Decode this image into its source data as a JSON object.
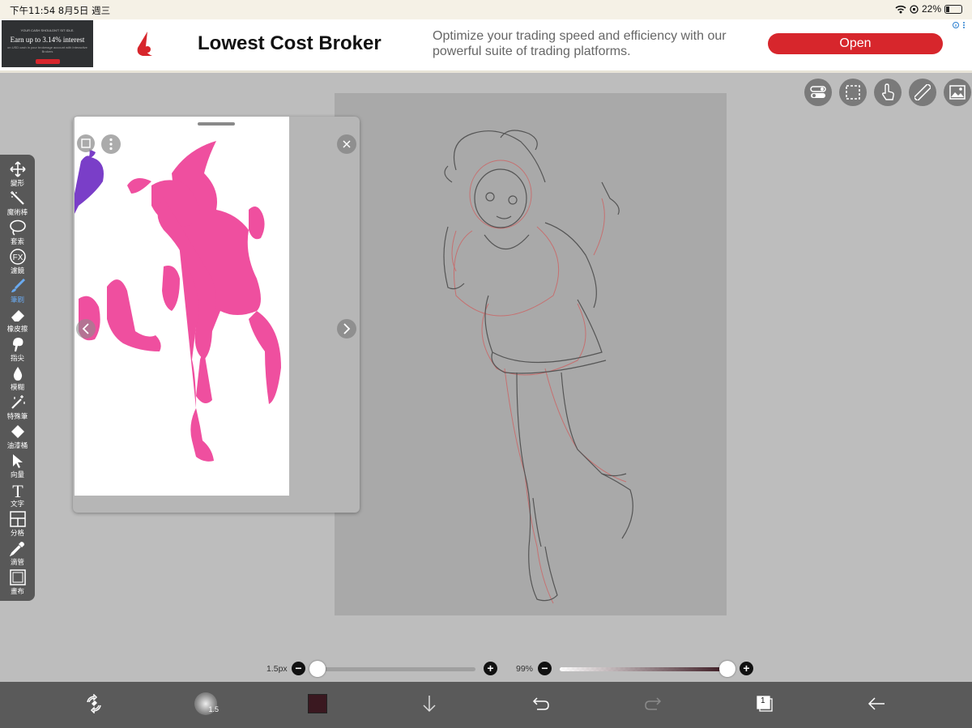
{
  "status": {
    "time": "下午11:54  8月5日 週三",
    "battery": "22%"
  },
  "ad": {
    "thumb_top": "YOUR CASH SHOULDN'T SIT IDLE.",
    "thumb_headline": "Earn up to 3.14% interest",
    "thumb_sub": "on USD cash in your brokerage account with Interactive Brokers",
    "title": "Lowest Cost Broker",
    "description": "Optimize your trading speed and efficiency with our powerful suite of trading platforms.",
    "cta": "Open",
    "accent": "#d7262c"
  },
  "toolbar": {
    "items": [
      {
        "label": "變形",
        "icon": "move-icon"
      },
      {
        "label": "魔術棒",
        "icon": "magic-wand-icon"
      },
      {
        "label": "套索",
        "icon": "lasso-icon"
      },
      {
        "label": "濾鏡",
        "icon": "fx-icon"
      },
      {
        "label": "筆刷",
        "icon": "brush-icon",
        "active": true
      },
      {
        "label": "橡皮擦",
        "icon": "eraser-icon"
      },
      {
        "label": "指尖",
        "icon": "smudge-icon"
      },
      {
        "label": "模糊",
        "icon": "blur-icon"
      },
      {
        "label": "特殊筆",
        "icon": "special-pen-icon"
      },
      {
        "label": "油漆桶",
        "icon": "bucket-icon"
      },
      {
        "label": "向量",
        "icon": "vector-icon"
      },
      {
        "label": "文字",
        "icon": "text-icon"
      },
      {
        "label": "分格",
        "icon": "frame-divider-icon"
      },
      {
        "label": "滴管",
        "icon": "eyedropper-icon"
      },
      {
        "label": "畫布",
        "icon": "canvas-icon"
      }
    ],
    "active_color": "#6aaaf0"
  },
  "fx_glyph": "FX",
  "text_glyph": "T",
  "sliders": {
    "size_label": "1.5px",
    "size_fraction": 0.0,
    "opacity_label": "99%",
    "opacity_fraction": 0.99,
    "minus": "−",
    "plus": "+"
  },
  "bottom": {
    "brush_size": "1.5",
    "current_color": "#3a1820",
    "layer_count": "1"
  }
}
